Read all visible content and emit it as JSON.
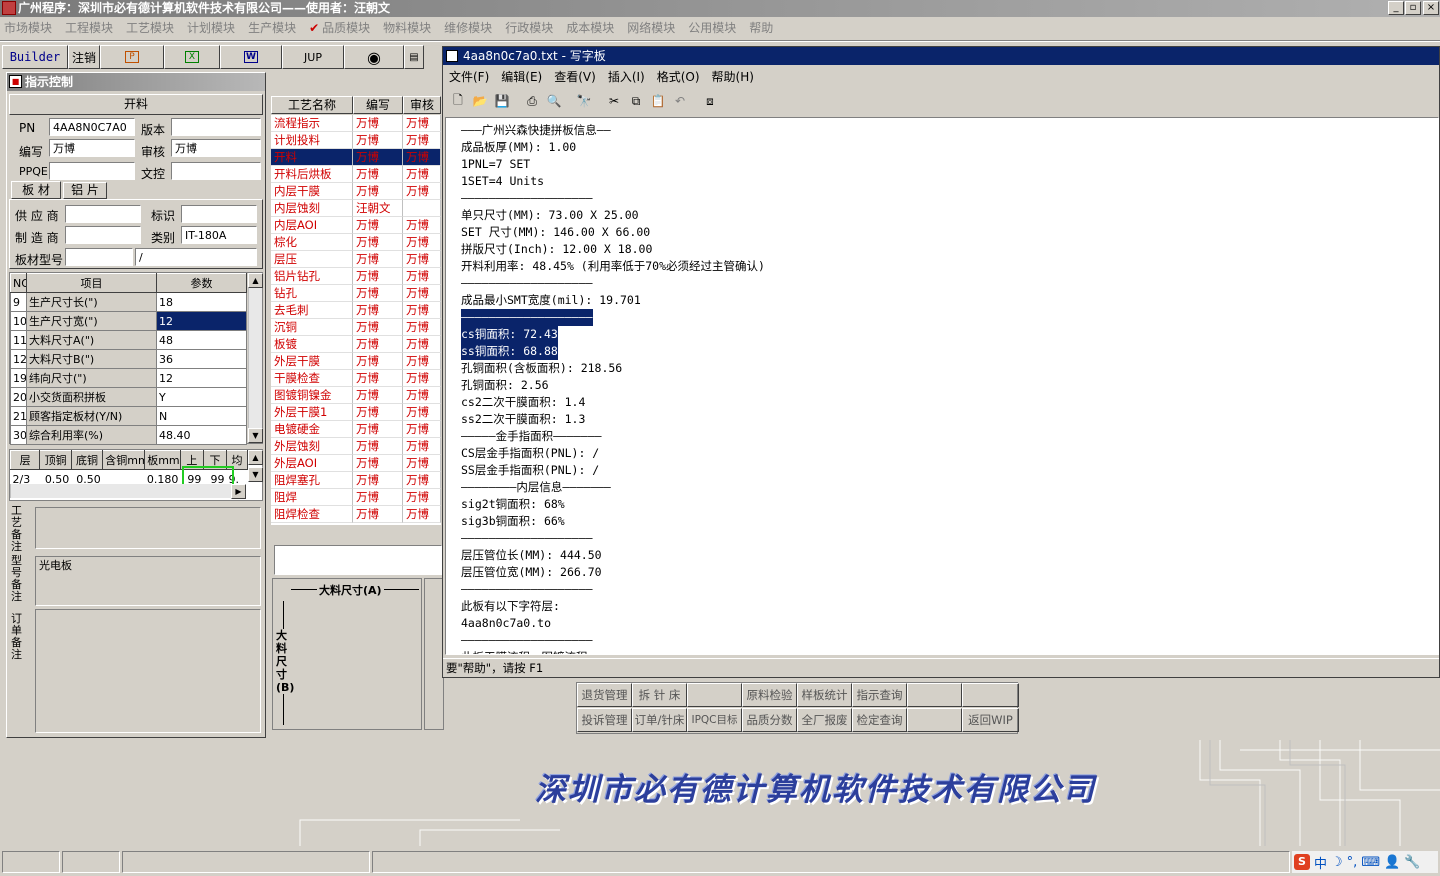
{
  "app": {
    "title": "广州程序：深圳市必有德计算机软件技术有限公司——使用者：汪朝文",
    "min": "_",
    "max": "▫",
    "close": "×"
  },
  "menu": [
    "市场模块",
    "工程模块",
    "工艺模块",
    "计划模块",
    "生产模块",
    "品质模块",
    "物料模块",
    "维修模块",
    "行政模块",
    "成本模块",
    "网络模块",
    "公用模块",
    "帮助"
  ],
  "toolbar": {
    "builder": "Builder",
    "logout": "注销",
    "jup": "JUP"
  },
  "panel": {
    "title": "指示控制",
    "section": "开料",
    "fields": {
      "pn_label": "PN",
      "pn": "4AA8N0C7A0",
      "version_label": "版本",
      "version": "",
      "writer_label": "编写",
      "writer": "万博",
      "reviewer_label": "审核",
      "reviewer": "万博",
      "ppqe_label": "PPQE",
      "ppqe": "",
      "doc_label": "文控",
      "doc": ""
    },
    "tabs": [
      "板 材",
      "铝 片"
    ],
    "mat": {
      "supplier_label": "供 应 商",
      "supplier": "",
      "mark_label": "标识",
      "mark": "",
      "maker_label": "制 造 商",
      "maker": "",
      "cat_label": "类别",
      "cat": "IT-180A",
      "model_label": "板材型号",
      "model": "",
      "model2": "/"
    },
    "param_headers": [
      "NO",
      "项目",
      "参数"
    ],
    "params": [
      [
        "9",
        "生产尺寸长(\")",
        "18"
      ],
      [
        "10",
        "生产尺寸宽(\")",
        "12"
      ],
      [
        "11",
        "大料尺寸A(\")",
        "48"
      ],
      [
        "12",
        "大料尺寸B(\")",
        "36"
      ],
      [
        "19",
        "纬向尺寸(\")",
        "12"
      ],
      [
        "20",
        "小交货面积拼板",
        "Y"
      ],
      [
        "21",
        "顾客指定板材(Y/N)",
        "N"
      ],
      [
        "30",
        "综合利用率(%)",
        "48.40"
      ]
    ],
    "layer_headers": [
      "层",
      "顶铜",
      "底铜",
      "含铜mm",
      "板mm",
      "上",
      "下",
      "均"
    ],
    "layer_row": [
      "2/3",
      "0.50",
      "0.50",
      "",
      "0.180",
      "99",
      "99",
      "9."
    ],
    "notes": [
      {
        "label": "工艺备注",
        "value": ""
      },
      {
        "label": "型号备注",
        "value": "光电板"
      },
      {
        "label": "订单备注",
        "value": ""
      }
    ]
  },
  "proc": {
    "headers": [
      "工艺名称",
      "编写",
      "审核"
    ],
    "rows": [
      [
        "流程指示",
        "万博",
        "万博"
      ],
      [
        "计划投料",
        "万博",
        "万博"
      ],
      [
        "开料",
        "万博",
        "万博"
      ],
      [
        "开料后烘板",
        "万博",
        "万博"
      ],
      [
        "内层干膜",
        "万博",
        "万博"
      ],
      [
        "内层蚀刻",
        "汪朝文",
        ""
      ],
      [
        "内层AOI",
        "万博",
        "万博"
      ],
      [
        "棕化",
        "万博",
        "万博"
      ],
      [
        "层压",
        "万博",
        "万博"
      ],
      [
        "铝片钻孔",
        "万博",
        "万博"
      ],
      [
        "钻孔",
        "万博",
        "万博"
      ],
      [
        "去毛刺",
        "万博",
        "万博"
      ],
      [
        "沉铜",
        "万博",
        "万博"
      ],
      [
        "板镀",
        "万博",
        "万博"
      ],
      [
        "外层干膜",
        "万博",
        "万博"
      ],
      [
        "干膜检查",
        "万博",
        "万博"
      ],
      [
        "图镀铜镍金",
        "万博",
        "万博"
      ],
      [
        "外层干膜1",
        "万博",
        "万博"
      ],
      [
        "电镀硬金",
        "万博",
        "万博"
      ],
      [
        "外层蚀刻",
        "万博",
        "万博"
      ],
      [
        "外层AOI",
        "万博",
        "万博"
      ],
      [
        "阻焊塞孔",
        "万博",
        "万博"
      ],
      [
        "阻焊",
        "万博",
        "万博"
      ],
      [
        "阻焊检查",
        "万博",
        "万博"
      ]
    ]
  },
  "diagram": {
    "a_label": "大料尺寸(A)",
    "b_label": "大料尺寸(B)"
  },
  "wordpad": {
    "title": "4aa8n0c7a0.txt - 写字板",
    "menu": [
      "文件(F)",
      "编辑(E)",
      "查看(V)",
      "插入(I)",
      "格式(O)",
      "帮助(H)"
    ],
    "lines": [
      "———广州兴森快捷拼板信息——",
      "成品板厚(MM): 1.00",
      "1PNL=7 SET",
      "1SET=4 Units",
      "———————————————————",
      "单只尺寸(MM): 73.00 X 25.00",
      "SET 尺寸(MM): 146.00 X 66.00",
      "拼版尺寸(Inch): 12.00 X 18.00",
      "开料利用率: 48.45% (利用率低于70%必须经过主管确认)",
      "———————————————————",
      "成品最小SMT宽度(mil): 19.701",
      "———————————————————",
      "cs铜面积: 72.43",
      "ss铜面积: 68.88",
      "孔铜面积(含板面积): 218.56",
      "孔铜面积: 2.56",
      "cs2二次干膜面积: 1.4",
      "ss2二次干膜面积: 1.3",
      "—————金手指面积———————",
      "CS层金手指面积(PNL): /",
      "SS层金手指面积(PNL): /",
      "————————内层信息———————",
      "sig2t铜面积: 68%",
      "sig3b铜面积: 66%",
      "———————————————————",
      "层压管位长(MM): 444.50",
      "层压管位宽(MM): 266.70",
      "———————————————————",
      "此板有以下字符层:",
      "4aa8n0c7a0.to",
      "———————————————————",
      "此板干膜流程，图镀流程"
    ],
    "status": "要\"帮助\"，请按 F1"
  },
  "buttons": [
    [
      "退货管理",
      "拆 针 床",
      "",
      "原料检验",
      "样板统计",
      "指示查询",
      "",
      ""
    ],
    [
      "投诉管理",
      "订单/针床",
      "IPQC目标",
      "品质分数",
      "全厂报废",
      "检定查询",
      "",
      "返回WIP"
    ]
  ],
  "banner": "深圳市必有德计算机软件技术有限公司",
  "tray": {
    "ime": "中"
  }
}
